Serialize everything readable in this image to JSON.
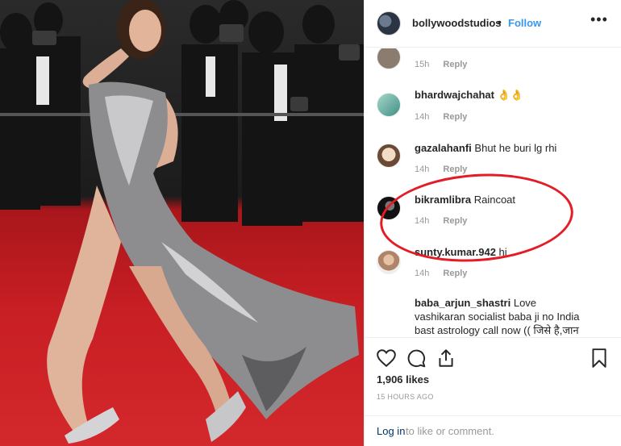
{
  "header": {
    "username": "bollywoodstudios",
    "dot": "•",
    "follow_label": "Follow",
    "more_icon": "more-dots-icon"
  },
  "comments": [
    {
      "user": "",
      "text": "",
      "time": "15h",
      "reply": "Reply",
      "avatar_color": "#8a7d70"
    },
    {
      "user": "bhardwajchahat",
      "text": "👌👌",
      "time": "14h",
      "reply": "Reply",
      "avatar_color": "#5aa7a0"
    },
    {
      "user": "gazalahanfi",
      "text": "Bhut he buri lg rhi",
      "time": "14h",
      "reply": "Reply",
      "avatar_color": "#d7c2a8"
    },
    {
      "user": "bikramlibra",
      "text": "Raincoat",
      "time": "14h",
      "reply": "Reply",
      "avatar_color": "#222222"
    },
    {
      "user": "sunty.kumar.942",
      "text": "hi",
      "time": "14h",
      "reply": "Reply",
      "avatar_color": "#c9a88e"
    },
    {
      "user": "baba_arjun_shastri",
      "text": "Love vashikaran socialist baba ji no India bast astrology call now (( जिसे है,जान वहा",
      "time": "",
      "reply": "",
      "avatar_color": "#ffffff"
    }
  ],
  "actions": {
    "like_icon": "heart-icon",
    "comment_icon": "comment-icon",
    "share_icon": "share-icon",
    "save_icon": "bookmark-icon"
  },
  "likes": "1,906 likes",
  "timestamp": "15 HOURS AGO",
  "login": {
    "link": "Log in",
    "rest": "to like or comment."
  },
  "colors": {
    "accent_blue": "#3897f0",
    "annotation_red": "#e41c25",
    "carpet_red": "#c81f24"
  }
}
